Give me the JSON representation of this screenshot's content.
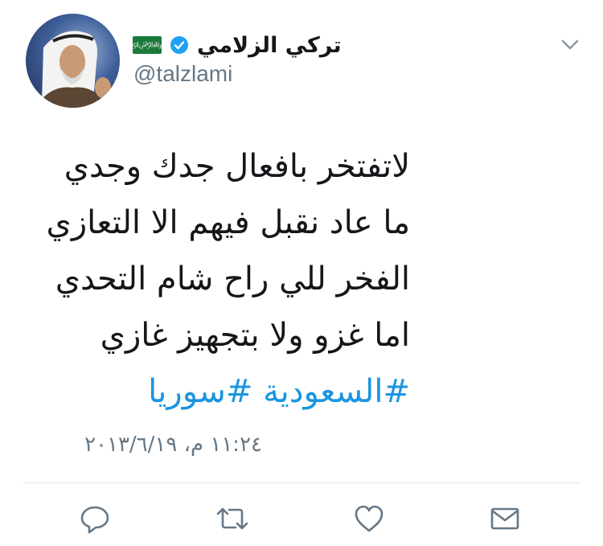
{
  "user": {
    "display_name": "تركي الزلامي",
    "handle": "@talzlami",
    "verified": true,
    "flag": "saudi-arabia-flag"
  },
  "tweet": {
    "lines": [
      "لاتفتخر بافعال جدك وجدي",
      "ما عاد نقبل فيهم الا التعازي",
      "الفخر للي راح شام التحدي",
      "اما غزو ولا بتجهيز غازي"
    ],
    "hashtags": [
      "#السعودية",
      "#سوريا"
    ],
    "timestamp": "١١:٢٤ م، ٢٠١٣/٦/١٩"
  },
  "actions": {
    "reply": "reply-icon",
    "retweet": "retweet-icon",
    "like": "heart-icon",
    "message": "envelope-icon"
  },
  "colors": {
    "text": "#14171a",
    "secondary": "#657786",
    "link": "#1b95e0",
    "verified": "#1da1f2",
    "flag": "#1b7a3a"
  }
}
